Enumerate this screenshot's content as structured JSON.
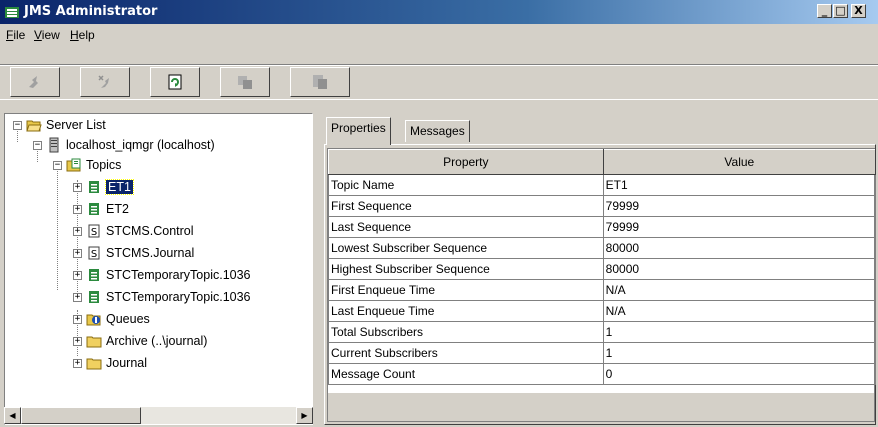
{
  "window": {
    "title": "JMS Administrator",
    "minimize": "_",
    "maximize": "□",
    "close": "X"
  },
  "menu": [
    {
      "label": "File",
      "accel": "F",
      "rest": "ile"
    },
    {
      "label": "View",
      "accel": "V",
      "rest": "iew"
    },
    {
      "label": "Help",
      "accel": "H",
      "rest": "elp"
    }
  ],
  "toolbar": {
    "buttons": [
      {
        "icon": "connect-icon",
        "enabled": false
      },
      {
        "icon": "disconnect-icon",
        "enabled": false
      },
      {
        "icon": "refresh-icon",
        "enabled": true
      },
      {
        "icon": "copy-icon",
        "enabled": false
      },
      {
        "icon": "paste-icon",
        "enabled": false
      }
    ]
  },
  "tree": {
    "root": "Server List",
    "server": "localhost_iqmgr (localhost)",
    "topics_label": "Topics",
    "topics": [
      "ET1",
      "ET2",
      "STCMS.Control",
      "STCMS.Journal",
      "STCTemporaryTopic.1036",
      "STCTemporaryTopic.1036"
    ],
    "selected": "ET1",
    "queues_label": "Queues",
    "archive_label": "Archive (..\\journal)",
    "journal_label": "Journal"
  },
  "tabs": [
    {
      "label": "Properties",
      "active": true
    },
    {
      "label": "Messages",
      "active": false
    }
  ],
  "table": {
    "headers": [
      "Property",
      "Value"
    ],
    "rows": [
      [
        "Topic Name",
        "ET1"
      ],
      [
        "First Sequence",
        "79999"
      ],
      [
        "Last Sequence",
        "79999"
      ],
      [
        "Lowest Subscriber Sequence",
        "80000"
      ],
      [
        "Highest Subscriber Sequence",
        "80000"
      ],
      [
        "First Enqueue Time",
        "N/A"
      ],
      [
        "Last Enqueue Time",
        "N/A"
      ],
      [
        "Total Subscribers",
        "1"
      ],
      [
        "Current Subscribers",
        "1"
      ],
      [
        "Message Count",
        "0"
      ]
    ]
  },
  "colors": {
    "titlebar": "#0a246a",
    "face": "#d4d0c8",
    "selection": "#0a246a"
  }
}
